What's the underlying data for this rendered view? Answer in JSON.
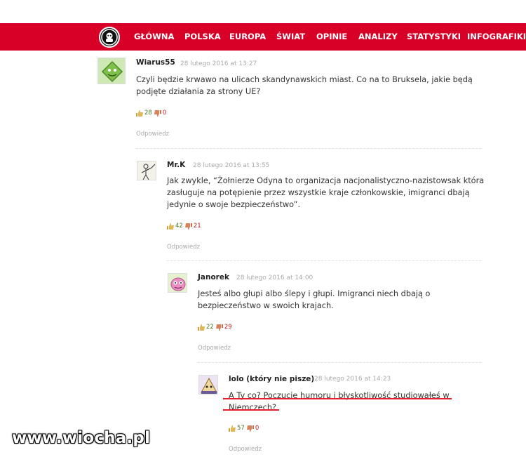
{
  "nav": {
    "items": [
      "GŁÓWNA",
      "POLSKA",
      "EUROPA",
      "ŚWIAT",
      "OPINIE",
      "ANALIZY",
      "STATYSTYKI",
      "INFOGRAFIKI"
    ]
  },
  "colors": {
    "brand_red": "#d80026",
    "underline_red": "#e4202c"
  },
  "comments": [
    {
      "author": "Wiarus55",
      "date": "28 lutego 2016 at 13:27",
      "text_lines": [
        "Czyli będzie krwawo na ulicach skandynawskich miast. Co na to Bruksela, jakie będą",
        "podjęte działania za strony UE?"
      ],
      "votes_up": "28",
      "votes_down": "0",
      "reply": "Odpowiedz",
      "avatar_icon": "green-diamond-face-icon"
    },
    {
      "author": "Mr.K",
      "date": "28 lutego 2016 at 13:55",
      "text_lines": [
        "Jak zwykle, “Żołnierze Odyna to organizacja nacjonalistyczno-nazistowsak która",
        "zasługuje na potępienie przez wszystkie kraje członkowskie, imigranci dbają",
        "jedynie o swoje bezpieczeństwo”."
      ],
      "votes_up": "42",
      "votes_down": "21",
      "reply": "Odpowiedz",
      "avatar_icon": "sketch-figure-icon"
    },
    {
      "author": "Janorek",
      "date": "28 lutego 2016 at 14:00",
      "text_lines": [
        "Jesteś albo głupi albo ślepy i głupi. Imigranci niech dbają o",
        "bezpieczeństwo w swoich krajach."
      ],
      "votes_up": "22",
      "votes_down": "29",
      "reply": "Odpowiedz",
      "avatar_icon": "pink-monster-icon"
    },
    {
      "author": "lolo (który nie pisze)",
      "date": "28 lutego 2016 at 14:23",
      "text_lines": [
        "A Ty co? Poczucie humoru i błyskotliwość studiowałeś w",
        "Niemczech?"
      ],
      "votes_up": "57",
      "votes_down": "0",
      "reply": "Odpowiedz",
      "avatar_icon": "pyramid-figure-icon"
    }
  ],
  "watermark": "www.wiocha.pl"
}
